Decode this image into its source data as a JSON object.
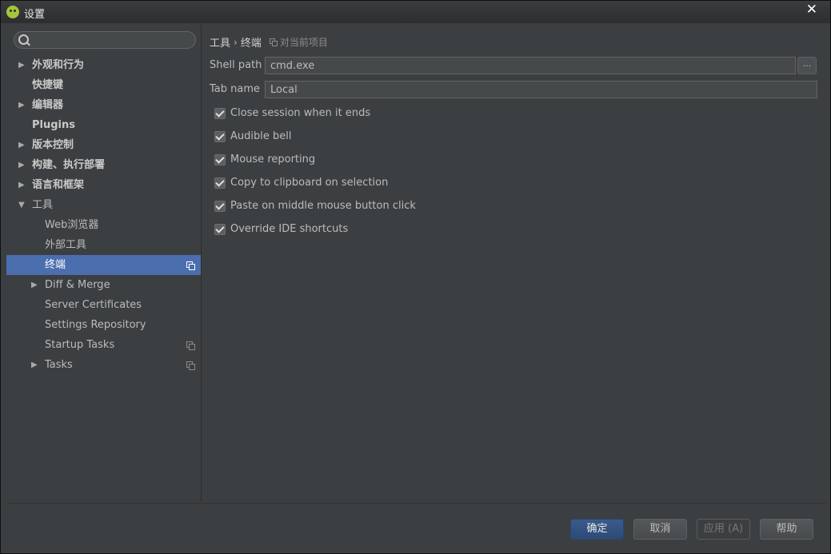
{
  "window": {
    "title": "设置"
  },
  "search": {
    "value": "",
    "placeholder": ""
  },
  "sidebar": {
    "items": [
      {
        "label": "外观和行为",
        "expandable": true,
        "expanded": false,
        "bold": true,
        "indent": 0
      },
      {
        "label": "快捷键",
        "expandable": false,
        "bold": true,
        "indent": 0
      },
      {
        "label": "编辑器",
        "expandable": true,
        "expanded": false,
        "bold": true,
        "indent": 0
      },
      {
        "label": "Plugins",
        "expandable": false,
        "bold": true,
        "indent": 0
      },
      {
        "label": "版本控制",
        "expandable": true,
        "expanded": false,
        "bold": true,
        "indent": 0
      },
      {
        "label": "构建、执行部署",
        "expandable": true,
        "expanded": false,
        "bold": true,
        "indent": 0
      },
      {
        "label": "语言和框架",
        "expandable": true,
        "expanded": false,
        "bold": true,
        "indent": 0
      },
      {
        "label": "工具",
        "expandable": true,
        "expanded": true,
        "bold": false,
        "indent": 0
      },
      {
        "label": "Web浏览器",
        "expandable": false,
        "bold": false,
        "indent": 1
      },
      {
        "label": "外部工具",
        "expandable": false,
        "bold": false,
        "indent": 1
      },
      {
        "label": "终端",
        "expandable": false,
        "bold": false,
        "indent": 1,
        "selected": true,
        "project_icon": true
      },
      {
        "label": "Diff & Merge",
        "expandable": true,
        "expanded": false,
        "bold": false,
        "indent": 1
      },
      {
        "label": "Server Certificates",
        "expandable": false,
        "bold": false,
        "indent": 1
      },
      {
        "label": "Settings Repository",
        "expandable": false,
        "bold": false,
        "indent": 1
      },
      {
        "label": "Startup Tasks",
        "expandable": false,
        "bold": false,
        "indent": 1,
        "project_icon": true
      },
      {
        "label": "Tasks",
        "expandable": true,
        "expanded": false,
        "bold": false,
        "indent": 1,
        "project_icon": true
      }
    ]
  },
  "breadcrumb": {
    "parent": "工具",
    "separator": "›",
    "current": "终端",
    "scope": "对当前项目"
  },
  "form": {
    "shell_path": {
      "label": "Shell path",
      "value": "cmd.exe",
      "browse_label": "..."
    },
    "tab_name": {
      "label": "Tab name",
      "value": "Local"
    },
    "checkboxes": [
      {
        "label": "Close session when it ends",
        "checked": true
      },
      {
        "label": "Audible bell",
        "checked": true
      },
      {
        "label": "Mouse reporting",
        "checked": true
      },
      {
        "label": "Copy to clipboard on selection",
        "checked": true
      },
      {
        "label": "Paste on middle mouse button click",
        "checked": true
      },
      {
        "label": "Override IDE shortcuts",
        "checked": true
      }
    ]
  },
  "footer": {
    "ok": "确定",
    "cancel": "取消",
    "apply": "应用 (A)",
    "help": "帮助"
  },
  "colors": {
    "selection": "#4b6eaf",
    "background": "#3c3f41",
    "primary_button": "#365880"
  }
}
